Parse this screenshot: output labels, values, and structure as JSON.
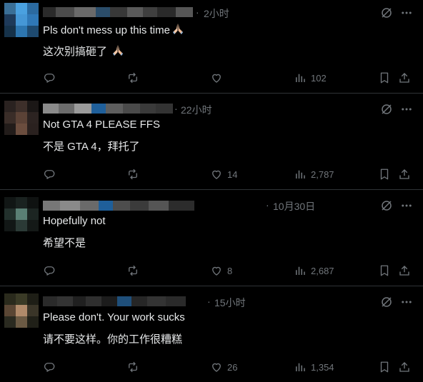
{
  "posts": [
    {
      "time": "2小时",
      "text_en": "Pls don't mess up this time",
      "text_zh": "这次别搞砸了",
      "has_emoji": true,
      "likes": "",
      "views": "102",
      "avatar_colors": [
        "#3a6f97",
        "#4aa1e0",
        "#2b6aa0",
        "#1e3a5a",
        "#4597d6",
        "#2f78b7",
        "#16324a",
        "#2d76b0",
        "#1e4a70"
      ],
      "name_blocks": [
        "#2a2a2a",
        "#4c4c4c",
        "#6a6a6a",
        "#2b4d6a",
        "#383838",
        "#5a5a5a",
        "#3f3f3f",
        "#2a2a2a",
        "#565656"
      ]
    },
    {
      "time": "22小时",
      "text_en": "Not GTA 4 PLEASE FFS",
      "text_zh": "不是 GTA 4，拜托了",
      "has_emoji": false,
      "likes": "14",
      "views": "2,787",
      "avatar_colors": [
        "#2a2220",
        "#3d2f2a",
        "#1b1716",
        "#3a2d28",
        "#5b4236",
        "#2c2321",
        "#221c1a",
        "#6b4d3e",
        "#2a211f"
      ],
      "name_blocks": [
        "#8a8a8a",
        "#6c6c6c",
        "#9a9a9a",
        "#1f5f9a",
        "#5e5e5e",
        "#4a4a4a",
        "#3a3a3a",
        "#333333"
      ]
    },
    {
      "time": "10月30日",
      "text_en": "Hopefully not",
      "text_zh": "希望不是",
      "has_emoji": false,
      "likes": "8",
      "views": "2,687",
      "avatar_colors": [
        "#111615",
        "#1a2220",
        "#0f1211",
        "#22302c",
        "#5a7f74",
        "#1c2522",
        "#121716",
        "#2b3a36",
        "#141917"
      ],
      "name_blocks": [
        "#777777",
        "#8a8a8a",
        "#6a6a6a",
        "#1f5f9a",
        "#4d4d4d",
        "#3b3b3b",
        "#555555",
        "#2c2c2c"
      ]
    },
    {
      "time": "15小时",
      "text_en": "Please don't. Your work sucks",
      "text_zh": "请不要这样。你的工作很糟糕",
      "has_emoji": false,
      "likes": "26",
      "views": "1,354",
      "avatar_colors": [
        "#2a2a1c",
        "#3a3a26",
        "#1e1e16",
        "#5a4634",
        "#b08a6a",
        "#3a3528",
        "#2a2a20",
        "#6b5a44",
        "#202018"
      ],
      "name_blocks": [
        "#2a2a2a",
        "#333333",
        "#202020",
        "#2f2f2f",
        "#1c1c1c",
        "#1f4f7a",
        "#262626",
        "#333333",
        "#2a2a2a"
      ]
    }
  ]
}
